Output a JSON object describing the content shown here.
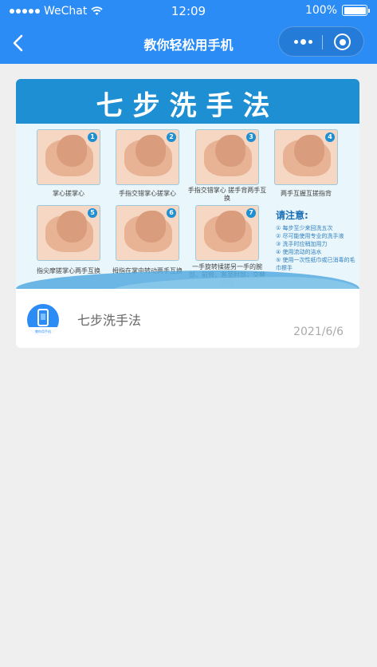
{
  "status_bar": {
    "carrier": "WeChat",
    "time": "12:09",
    "battery": "100%"
  },
  "nav": {
    "title": "教你轻松用手机"
  },
  "article": {
    "title": "七步洗手法",
    "date": "2021/6/6",
    "image": {
      "title": "七步洗手法",
      "steps": [
        {
          "num": "1",
          "caption": "掌心搓掌心"
        },
        {
          "num": "2",
          "caption": "手指交错掌心搓掌心"
        },
        {
          "num": "3",
          "caption": "手指交错掌心 搓手背两手互换"
        },
        {
          "num": "4",
          "caption": "两手互握互搓指背"
        },
        {
          "num": "5",
          "caption": "指尖摩搓掌心两手互换"
        },
        {
          "num": "6",
          "caption": "拇指在掌中转动两手互换"
        },
        {
          "num": "7",
          "caption": "一手旋转揉搓另一手的腕部、前臂，直至肘部；交替进行"
        }
      ],
      "notes_title": "请注意:",
      "notes": [
        "① 每步至少来回洗五次",
        "② 尽可能使用专业的洗手液",
        "③ 洗手时应稍加用力",
        "④ 使用流动的洁水",
        "⑤ 使用一次性纸巾或已消毒的毛巾擦手"
      ]
    },
    "source_icon_label": "教你用手机"
  },
  "colors": {
    "primary": "#2b8cf6",
    "background": "#efefef"
  }
}
